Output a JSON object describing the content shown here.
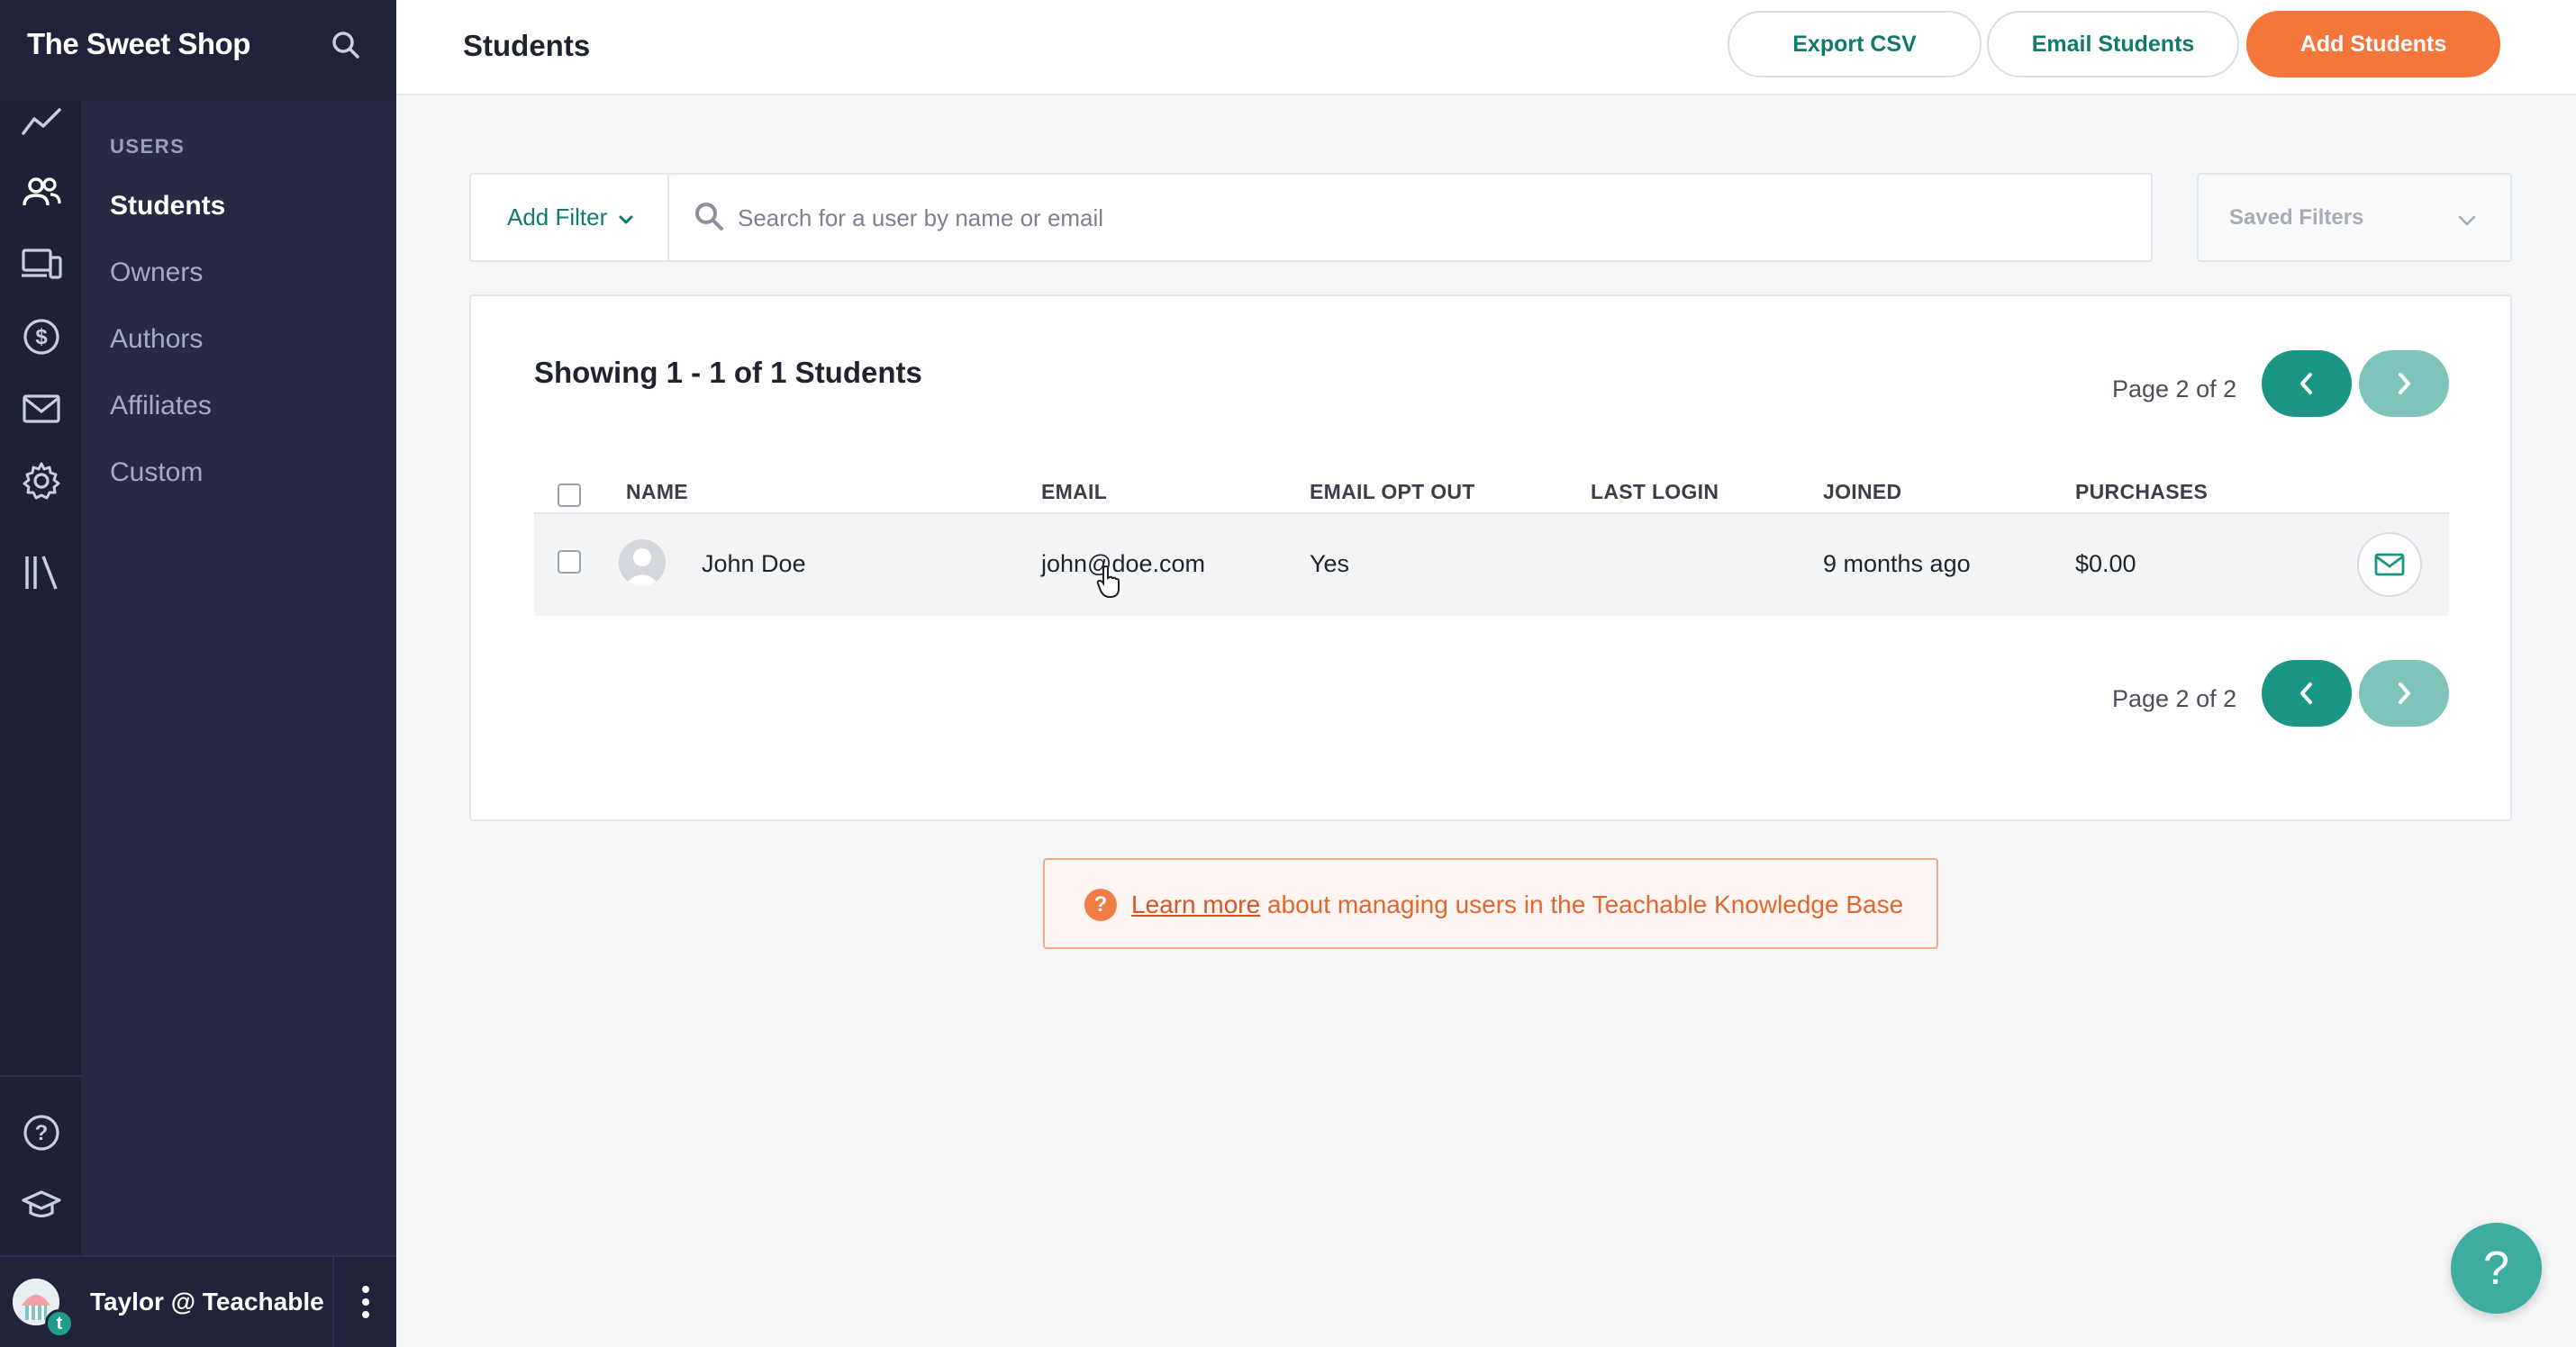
{
  "app": {
    "name": "The Sweet Shop"
  },
  "sidebar": {
    "rail_icons": [
      "analytics-icon",
      "users-icon",
      "devices-icon",
      "dollar-icon",
      "mail-icon",
      "gear-icon",
      "library-icon",
      "help-circle-icon",
      "graduation-cap-icon"
    ],
    "section_heading": "USERS",
    "items": [
      {
        "label": "Students",
        "active": true
      },
      {
        "label": "Owners",
        "active": false
      },
      {
        "label": "Authors",
        "active": false
      },
      {
        "label": "Affiliates",
        "active": false
      },
      {
        "label": "Custom",
        "active": false
      }
    ],
    "user": {
      "name": "Taylor @ Teachable",
      "badge": "t"
    }
  },
  "header": {
    "title": "Students",
    "export_label": "Export CSV",
    "email_label": "Email Students",
    "add_label": "Add Students"
  },
  "filters": {
    "add_filter_label": "Add Filter",
    "search_placeholder": "Search for a user by name or email",
    "saved_filters_label": "Saved Filters"
  },
  "results": {
    "showing_text": "Showing 1 - 1 of 1 Students",
    "page_text": "Page 2 of 2",
    "columns": {
      "name": "NAME",
      "email": "EMAIL",
      "email_opt_out": "EMAIL OPT OUT",
      "last_login": "LAST LOGIN",
      "joined": "JOINED",
      "purchases": "PURCHASES"
    },
    "rows": [
      {
        "name": "John Doe",
        "email": "john@doe.com",
        "email_opt_out": "Yes",
        "last_login": "",
        "joined": "9 months ago",
        "purchases": "$0.00"
      }
    ]
  },
  "knowledge_base": {
    "link_text": "Learn more",
    "rest_text": " about managing users in the Teachable Knowledge Base"
  },
  "help_fab": {
    "label": "?"
  },
  "colors": {
    "sidebar_bg": "#272a42",
    "accent_teal": "#1a9583",
    "primary_orange": "#f4763a",
    "notice_text": "#e0672f"
  }
}
